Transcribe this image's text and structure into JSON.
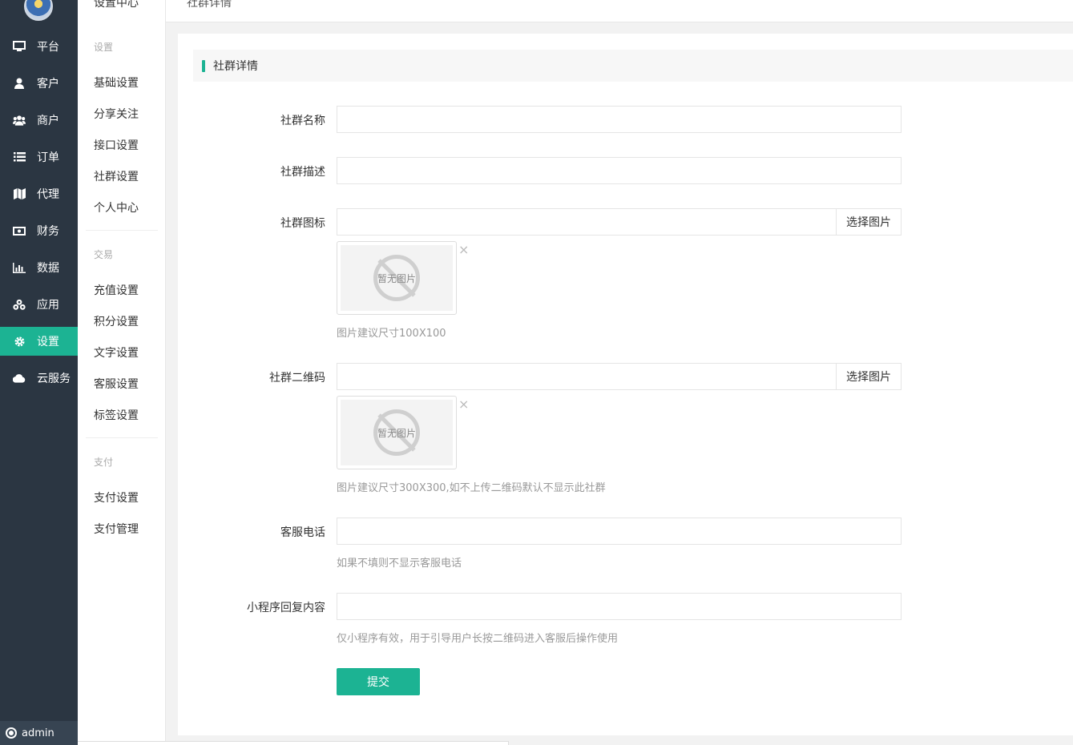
{
  "nav": {
    "items": [
      {
        "label": "平台",
        "icon": "monitor-icon"
      },
      {
        "label": "客户",
        "icon": "user-icon"
      },
      {
        "label": "商户",
        "icon": "users-icon"
      },
      {
        "label": "订单",
        "icon": "list-icon"
      },
      {
        "label": "代理",
        "icon": "map-icon"
      },
      {
        "label": "财务",
        "icon": "money-icon"
      },
      {
        "label": "数据",
        "icon": "bar-chart-icon"
      },
      {
        "label": "应用",
        "icon": "cubes-icon"
      },
      {
        "label": "设置",
        "icon": "gear-icon",
        "active": true
      },
      {
        "label": "云服务",
        "icon": "cloud-icon"
      }
    ],
    "user": "admin",
    "active_color": "#1cb393"
  },
  "submenu": {
    "title": "设置中心",
    "groups": [
      {
        "label": "设置",
        "items": [
          "基础设置",
          "分享关注",
          "接口设置",
          "社群设置",
          "个人中心"
        ]
      },
      {
        "label": "交易",
        "items": [
          "充值设置",
          "积分设置",
          "文字设置",
          "客服设置",
          "标签设置"
        ]
      },
      {
        "label": "支付",
        "items": [
          "支付设置",
          "支付管理"
        ]
      }
    ]
  },
  "topbar": {
    "crumb": "社群详情"
  },
  "panel": {
    "title": "社群详情",
    "form": {
      "name_label": "社群名称",
      "name_value": "",
      "desc_label": "社群描述",
      "desc_value": "",
      "icon_label": "社群图标",
      "icon_value": "",
      "icon_button": "选择图片",
      "icon_placeholder_text": "暂无图片",
      "icon_hint": "图片建议尺寸100X100",
      "qrcode_label": "社群二维码",
      "qrcode_value": "",
      "qrcode_button": "选择图片",
      "qrcode_placeholder_text": "暂无图片",
      "qrcode_hint": "图片建议尺寸300X300,如不上传二维码默认不显示此社群",
      "phone_label": "客服电话",
      "phone_value": "",
      "phone_hint": "如果不填则不显示客服电话",
      "reply_label": "小程序回复内容",
      "reply_value": "",
      "reply_hint": "仅小程序有效，用于引导用户长按二维码进入客服后操作使用",
      "submit_label": "提交"
    }
  }
}
